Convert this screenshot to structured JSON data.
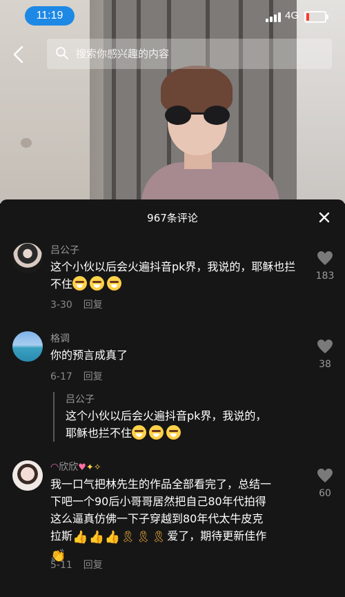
{
  "status_bar": {
    "time": "11:19",
    "network": "4G",
    "battery_level": 0.15
  },
  "search": {
    "placeholder": "搜索你感兴趣的内容"
  },
  "comments_panel": {
    "title": "967条评论",
    "comments": [
      {
        "username": "吕公子",
        "text": "这个小伙以后会火遍抖音pk界，我说的，耶稣也拦不住",
        "date": "3-30",
        "reply_label": "回复",
        "likes": "183"
      },
      {
        "username": "格调",
        "text": "你的预言成真了",
        "date": "6-17",
        "reply_label": "回复",
        "likes": "38",
        "quoted": {
          "username": "吕公子",
          "line1": "这个小伙以后会火遍抖音pk界，我说的，",
          "line2": "耶稣也拦不住"
        }
      },
      {
        "username": "欣欣",
        "line1": "我一口气把林先生的作品全部看完了，总结一",
        "line2": "下吧一个90后小哥哥居然把自己80年代拍得",
        "line3": "这么逼真仿佛一下子穿越到80年代太牛皮克",
        "line4_start": "拉斯",
        "line4_end": "爱了，期待更新佳作",
        "date": "5-11",
        "reply_label": "回复",
        "likes": "60"
      }
    ]
  },
  "colors": {
    "accent": "#1e88e5",
    "panel_bg": "#161616",
    "text_secondary": "#9a9a9a"
  },
  "icons": [
    "back-arrow-icon",
    "search-icon",
    "close-icon",
    "heart-icon",
    "grinning-emoji-icon",
    "thumbs-up-emoji-icon",
    "ribbon-emoji-icon",
    "clap-emoji-icon",
    "rainbow-emoji-icon",
    "heart-emoji-icon",
    "sparkles-emoji-icon"
  ]
}
